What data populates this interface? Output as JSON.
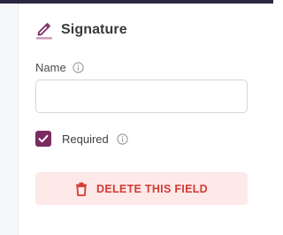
{
  "section": {
    "title": "Signature",
    "icon": "pencil-icon",
    "accent_color": "#7a2b60"
  },
  "name_field": {
    "label": "Name",
    "value": "",
    "placeholder": "",
    "info_icon": "info-icon"
  },
  "required": {
    "label": "Required",
    "checked": true,
    "info_icon": "info-icon"
  },
  "delete_button": {
    "label": "DELETE THIS FIELD",
    "icon": "trash-icon",
    "color": "#d43a35",
    "background": "#fde9e8"
  }
}
